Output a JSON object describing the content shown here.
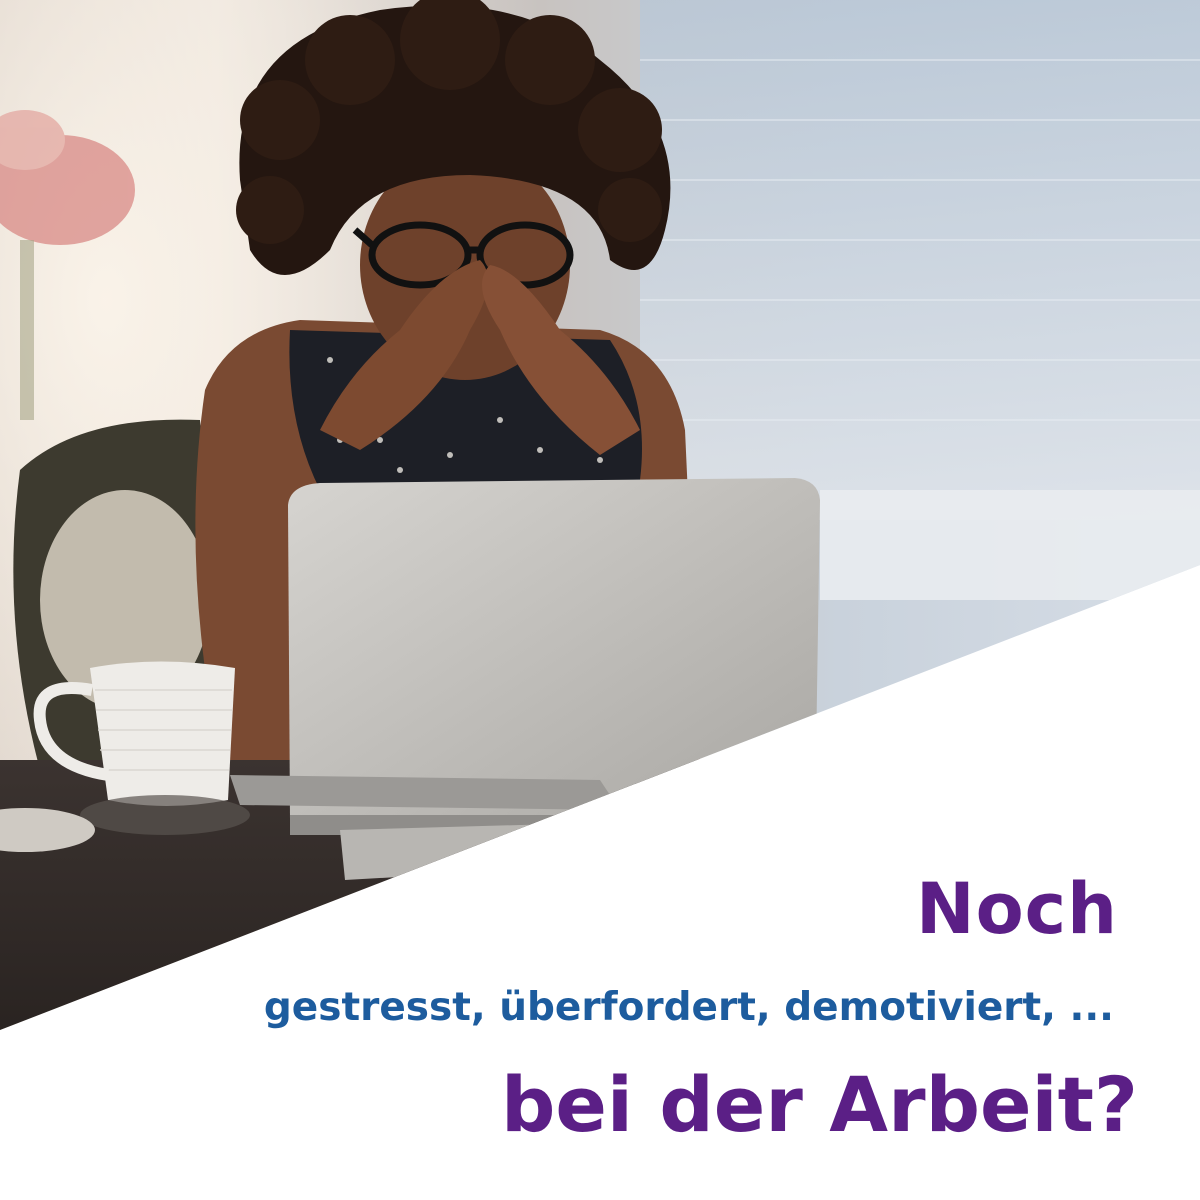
{
  "headline": {
    "line1": "Noch",
    "line2": "gestresst, überfordert, demotiviert, ...",
    "line3": "bei der Arbeit?"
  },
  "colors": {
    "purple": "#5b1f86",
    "blue": "#1d5c9e",
    "panel": "#ffffff"
  }
}
